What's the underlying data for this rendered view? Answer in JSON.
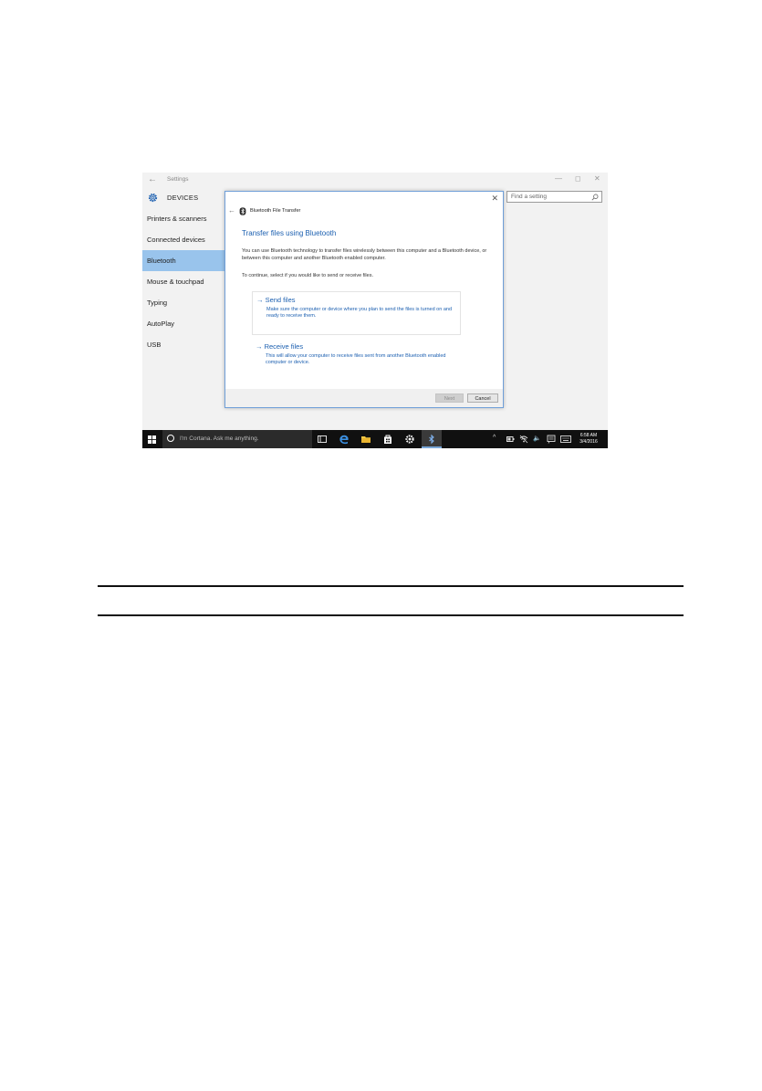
{
  "settings": {
    "title": "Settings",
    "back": "←",
    "window_controls": {
      "minimize": "—",
      "restore": "◻",
      "close": "✕"
    },
    "section": "DEVICES",
    "search_placeholder": "Find a setting",
    "nav": [
      "Printers & scanners",
      "Connected devices",
      "Bluetooth",
      "Mouse & touchpad",
      "Typing",
      "AutoPlay",
      "USB"
    ],
    "active_nav": "Bluetooth"
  },
  "dialog": {
    "window_title": "Bluetooth File Transfer",
    "close": "✕",
    "back": "←",
    "heading": "Transfer files using Bluetooth",
    "description": "You can use Bluetooth technology to transfer files wirelessly between this computer and a Bluetooth device, or between this computer and another Bluetooth enabled computer.",
    "instruction": "To continue, select if you would like to send or receive files.",
    "send": {
      "title": "→ Send files",
      "description": "Make sure the computer or device where you plan to send the files is turned on and ready to receive them."
    },
    "receive": {
      "title": "→ Receive files",
      "description": "This will allow your computer to receive files sent from another Bluetooth enabled computer or device."
    },
    "next_label": "Next",
    "cancel_label": "Cancel"
  },
  "taskbar": {
    "cortana_placeholder": "I'm Cortana. Ask me anything.",
    "time": "6:58 AM",
    "date": "3/4/2016",
    "tray": {
      "chevron": "^",
      "volume": "🔈"
    }
  },
  "colors": {
    "accent": "#1b5fb0",
    "selected_nav": "#99c4ec",
    "taskbar": "#101010",
    "dialog_border": "#6f9fd8"
  }
}
